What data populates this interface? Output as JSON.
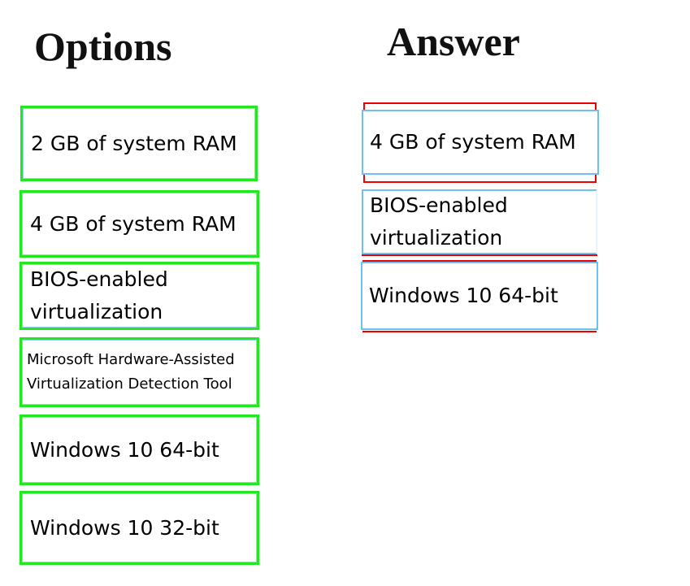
{
  "options_title": "Options",
  "answer_title": "Answer",
  "options": [
    "2 GB of system RAM",
    "4 GB of system RAM",
    "BIOS-enabled virtualization",
    "Microsoft Hardware-Assisted Virtualization Detection Tool",
    "Windows 10 64-bit",
    "Windows 10 32-bit"
  ],
  "answers": [
    "4 GB of system RAM",
    "BIOS-enabled virtualization",
    "Windows 10 64-bit"
  ],
  "colors": {
    "option_border": "#22e822",
    "answer_border": "#e00000",
    "answer_inner": "#6ec0f0"
  }
}
